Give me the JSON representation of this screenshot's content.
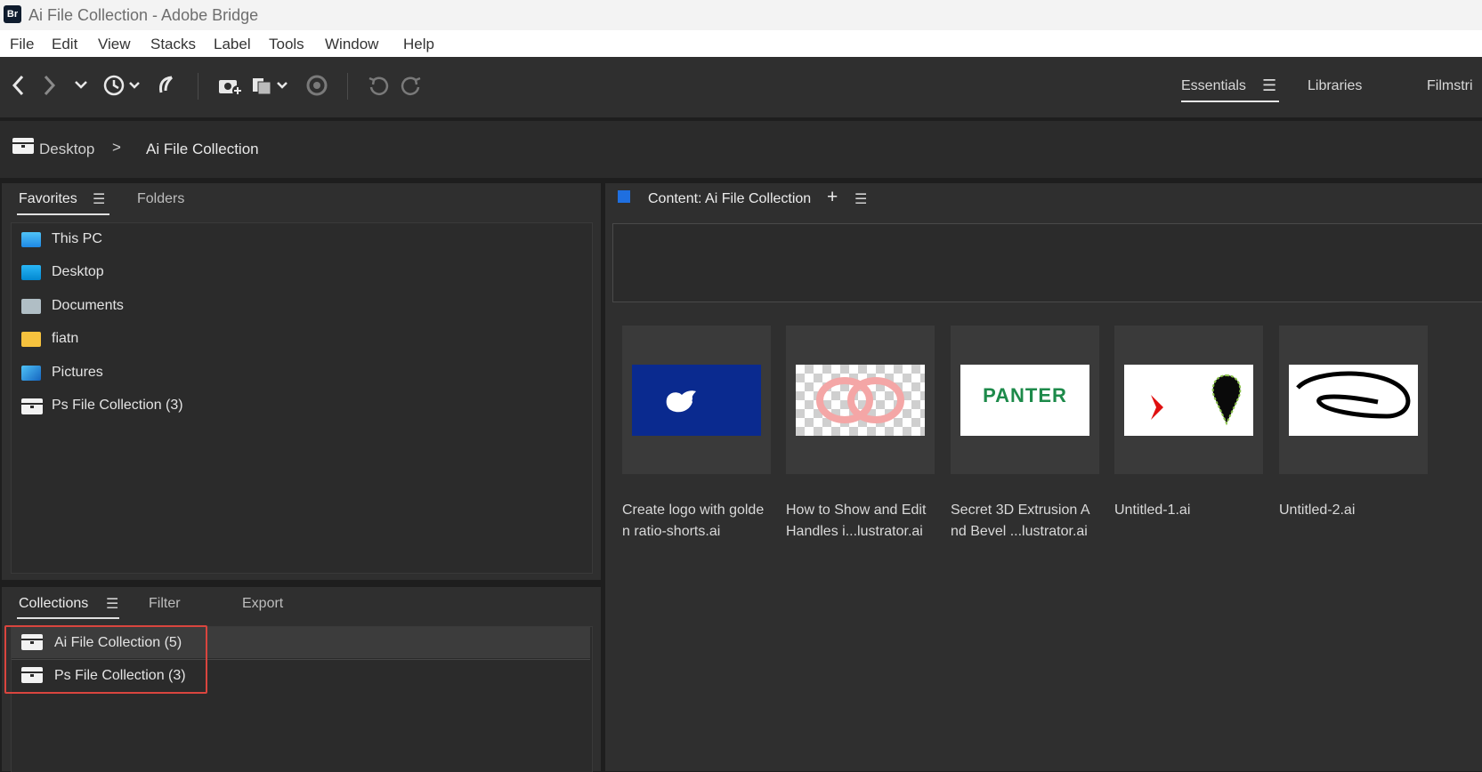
{
  "window": {
    "badge": "Br",
    "title": "Ai File Collection - Adobe Bridge"
  },
  "menu": [
    "File",
    "Edit",
    "View",
    "Stacks",
    "Label",
    "Tools",
    "Window",
    "Help"
  ],
  "workspaces": {
    "essentials": "Essentials",
    "libraries": "Libraries",
    "filmstrip": "Filmstri"
  },
  "path": {
    "root": "Desktop",
    "current": "Ai File Collection"
  },
  "left_top_panel": {
    "tabs": {
      "favorites": "Favorites",
      "folders": "Folders"
    },
    "items": [
      {
        "label": "This PC",
        "icon": "monitor-icon"
      },
      {
        "label": "Desktop",
        "icon": "desktop-folder-icon"
      },
      {
        "label": "Documents",
        "icon": "documents-folder-icon"
      },
      {
        "label": "fiatn",
        "icon": "folder-icon"
      },
      {
        "label": "Pictures",
        "icon": "pictures-folder-icon"
      },
      {
        "label": "Ps File Collection (3)",
        "icon": "collection-icon"
      }
    ]
  },
  "left_bottom_panel": {
    "tabs": {
      "collections": "Collections",
      "filter": "Filter",
      "export": "Export"
    },
    "items": [
      {
        "label": "Ai File Collection (5)"
      },
      {
        "label": "Ps File Collection (3)"
      }
    ]
  },
  "content": {
    "title": "Content: Ai File Collection",
    "add_glyph": "+",
    "items": [
      {
        "name": "Create logo with golde n ratio-shorts.ai",
        "line1": "Create logo with golde",
        "line2": "n ratio-shorts.ai"
      },
      {
        "name": "How to Show and Edit Handles i...lustrator.ai",
        "line1": "How to Show and Edit",
        "line2": "Handles i...lustrator.ai"
      },
      {
        "name": "Secret 3D Extrusion A nd Bevel ...lustrator.ai",
        "line1": "Secret 3D Extrusion A",
        "line2": "nd Bevel ...lustrator.ai"
      },
      {
        "name": "Untitled-1.ai",
        "line1": "Untitled-1.ai",
        "line2": ""
      },
      {
        "name": "Untitled-2.ai",
        "line1": "Untitled-2.ai",
        "line2": ""
      }
    ],
    "thumb3_text": "PANTER"
  },
  "colors": {
    "accent_blue": "#1f6fe0",
    "highlight_red": "#d9453e",
    "panel_bg": "#2f2f2f"
  }
}
